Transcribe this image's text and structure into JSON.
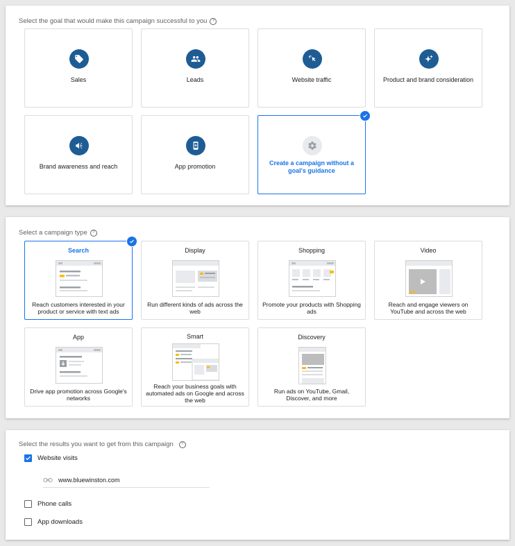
{
  "goal_section": {
    "label": "Select the goal that would make this campaign successful to you",
    "help": "?",
    "goals": [
      {
        "label": "Sales",
        "icon": "tag-icon"
      },
      {
        "label": "Leads",
        "icon": "people-icon"
      },
      {
        "label": "Website traffic",
        "icon": "cursor-click-icon"
      },
      {
        "label": "Product and brand consideration",
        "icon": "sparkle-icon"
      },
      {
        "label": "Brand awareness and reach",
        "icon": "megaphone-icon"
      },
      {
        "label": "App promotion",
        "icon": "phone-icon"
      },
      {
        "label": "Create a campaign without a goal's guidance",
        "icon": "gear-icon",
        "selected": true
      }
    ]
  },
  "type_section": {
    "label": "Select a campaign type",
    "help": "?",
    "types": [
      {
        "title": "Search",
        "desc": "Reach customers interested in your product or service with text ads",
        "selected": true
      },
      {
        "title": "Display",
        "desc": "Run different kinds of ads across the web"
      },
      {
        "title": "Shopping",
        "desc": "Promote your products with Shopping ads"
      },
      {
        "title": "Video",
        "desc": "Reach and engage viewers on YouTube and across the web"
      },
      {
        "title": "App",
        "desc": "Drive app promotion across Google's networks"
      },
      {
        "title": "Smart",
        "desc": "Reach your business goals with automated ads on Google and across the web"
      },
      {
        "title": "Discovery",
        "desc": "Run ads on YouTube, Gmail, Discover, and more"
      }
    ]
  },
  "results_section": {
    "label": "Select the results you want to get from this campaign",
    "help": "?",
    "options": [
      {
        "label": "Website visits",
        "checked": true
      },
      {
        "label": "Phone calls",
        "checked": false
      },
      {
        "label": "App downloads",
        "checked": false
      }
    ],
    "url_value": "www.bluewinston.com"
  },
  "colors": {
    "accent": "#1a73e8",
    "icon_bg": "#1e5c94",
    "highlight": "#fbbc04"
  }
}
